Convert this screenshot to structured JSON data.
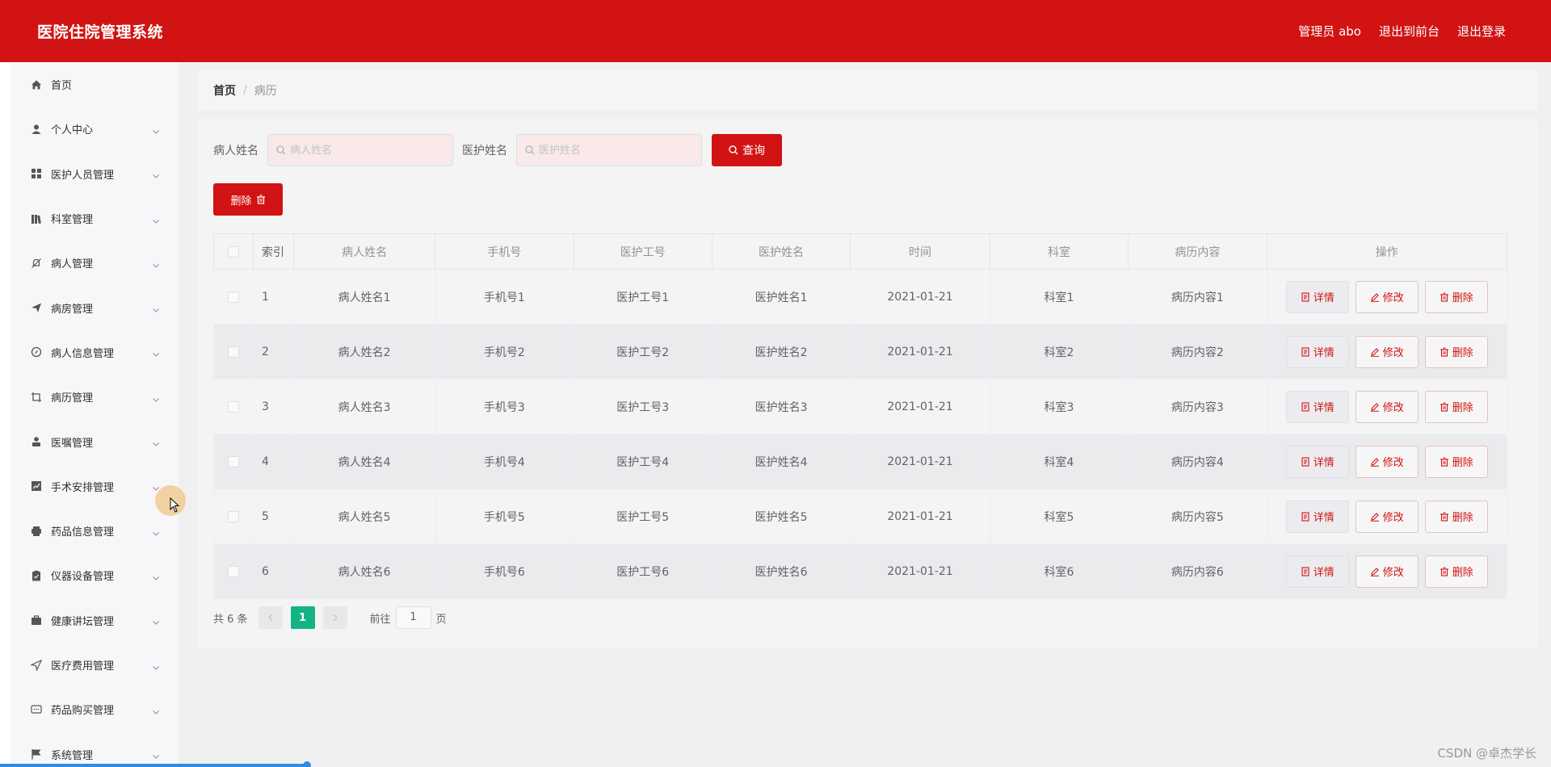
{
  "app": {
    "title": "医院住院管理系统",
    "user_label": "管理员 abo",
    "to_front": "退出到前台",
    "logout": "退出登录",
    "brand_color": "#d11313"
  },
  "sidebar": {
    "items": [
      {
        "label": "首页",
        "icon": "home-icon",
        "has_children": false
      },
      {
        "label": "个人中心",
        "icon": "user-icon",
        "has_children": true
      },
      {
        "label": "医护人员管理",
        "icon": "grid-icon",
        "has_children": true
      },
      {
        "label": "科室管理",
        "icon": "books-icon",
        "has_children": true
      },
      {
        "label": "病人管理",
        "icon": "no-bell-icon",
        "has_children": true
      },
      {
        "label": "病房管理",
        "icon": "send-icon",
        "has_children": true
      },
      {
        "label": "病人信息管理",
        "icon": "compass-icon",
        "has_children": true
      },
      {
        "label": "病历管理",
        "icon": "crop-icon",
        "has_children": true
      },
      {
        "label": "医嘱管理",
        "icon": "person-icon",
        "has_children": true
      },
      {
        "label": "手术安排管理",
        "icon": "chart-icon",
        "has_children": true
      },
      {
        "label": "药品信息管理",
        "icon": "printer-icon",
        "has_children": true
      },
      {
        "label": "仪器设备管理",
        "icon": "clipboard-icon",
        "has_children": true
      },
      {
        "label": "健康讲坛管理",
        "icon": "briefcase-icon",
        "has_children": true
      },
      {
        "label": "医疗费用管理",
        "icon": "navigation-icon",
        "has_children": true
      },
      {
        "label": "药品购买管理",
        "icon": "chat-icon",
        "has_children": true
      },
      {
        "label": "系统管理",
        "icon": "flag-icon",
        "has_children": true
      }
    ]
  },
  "breadcrumb": {
    "home": "首页",
    "separator": "/",
    "current": "病历"
  },
  "search": {
    "patient_label": "病人姓名",
    "patient_placeholder": "病人姓名",
    "patient_value": "",
    "nurse_label": "医护姓名",
    "nurse_placeholder": "医护姓名",
    "nurse_value": "",
    "query_button": "查询"
  },
  "toolbar": {
    "delete_button": "删除"
  },
  "table": {
    "headers": [
      "索引",
      "病人姓名",
      "手机号",
      "医护工号",
      "医护姓名",
      "时间",
      "科室",
      "病历内容",
      "操作"
    ],
    "rows": [
      {
        "index": "1",
        "patient": "病人姓名1",
        "phone": "手机号1",
        "staff_no": "医护工号1",
        "staff_name": "医护姓名1",
        "time": "2021-01-21",
        "dept": "科室1",
        "content": "病历内容1"
      },
      {
        "index": "2",
        "patient": "病人姓名2",
        "phone": "手机号2",
        "staff_no": "医护工号2",
        "staff_name": "医护姓名2",
        "time": "2021-01-21",
        "dept": "科室2",
        "content": "病历内容2"
      },
      {
        "index": "3",
        "patient": "病人姓名3",
        "phone": "手机号3",
        "staff_no": "医护工号3",
        "staff_name": "医护姓名3",
        "time": "2021-01-21",
        "dept": "科室3",
        "content": "病历内容3"
      },
      {
        "index": "4",
        "patient": "病人姓名4",
        "phone": "手机号4",
        "staff_no": "医护工号4",
        "staff_name": "医护姓名4",
        "time": "2021-01-21",
        "dept": "科室4",
        "content": "病历内容4"
      },
      {
        "index": "5",
        "patient": "病人姓名5",
        "phone": "手机号5",
        "staff_no": "医护工号5",
        "staff_name": "医护姓名5",
        "time": "2021-01-21",
        "dept": "科室5",
        "content": "病历内容5"
      },
      {
        "index": "6",
        "patient": "病人姓名6",
        "phone": "手机号6",
        "staff_no": "医护工号6",
        "staff_name": "医护姓名6",
        "time": "2021-01-21",
        "dept": "科室6",
        "content": "病历内容6"
      }
    ],
    "actions": {
      "detail": "详情",
      "edit": "修改",
      "delete": "删除"
    }
  },
  "pagination": {
    "total": "共 6 条",
    "current_page": "1",
    "goto_label": "前往",
    "goto_value": "1",
    "page_unit": "页",
    "active_color": "#13b386"
  },
  "watermark": "CSDN @卓杰学长"
}
